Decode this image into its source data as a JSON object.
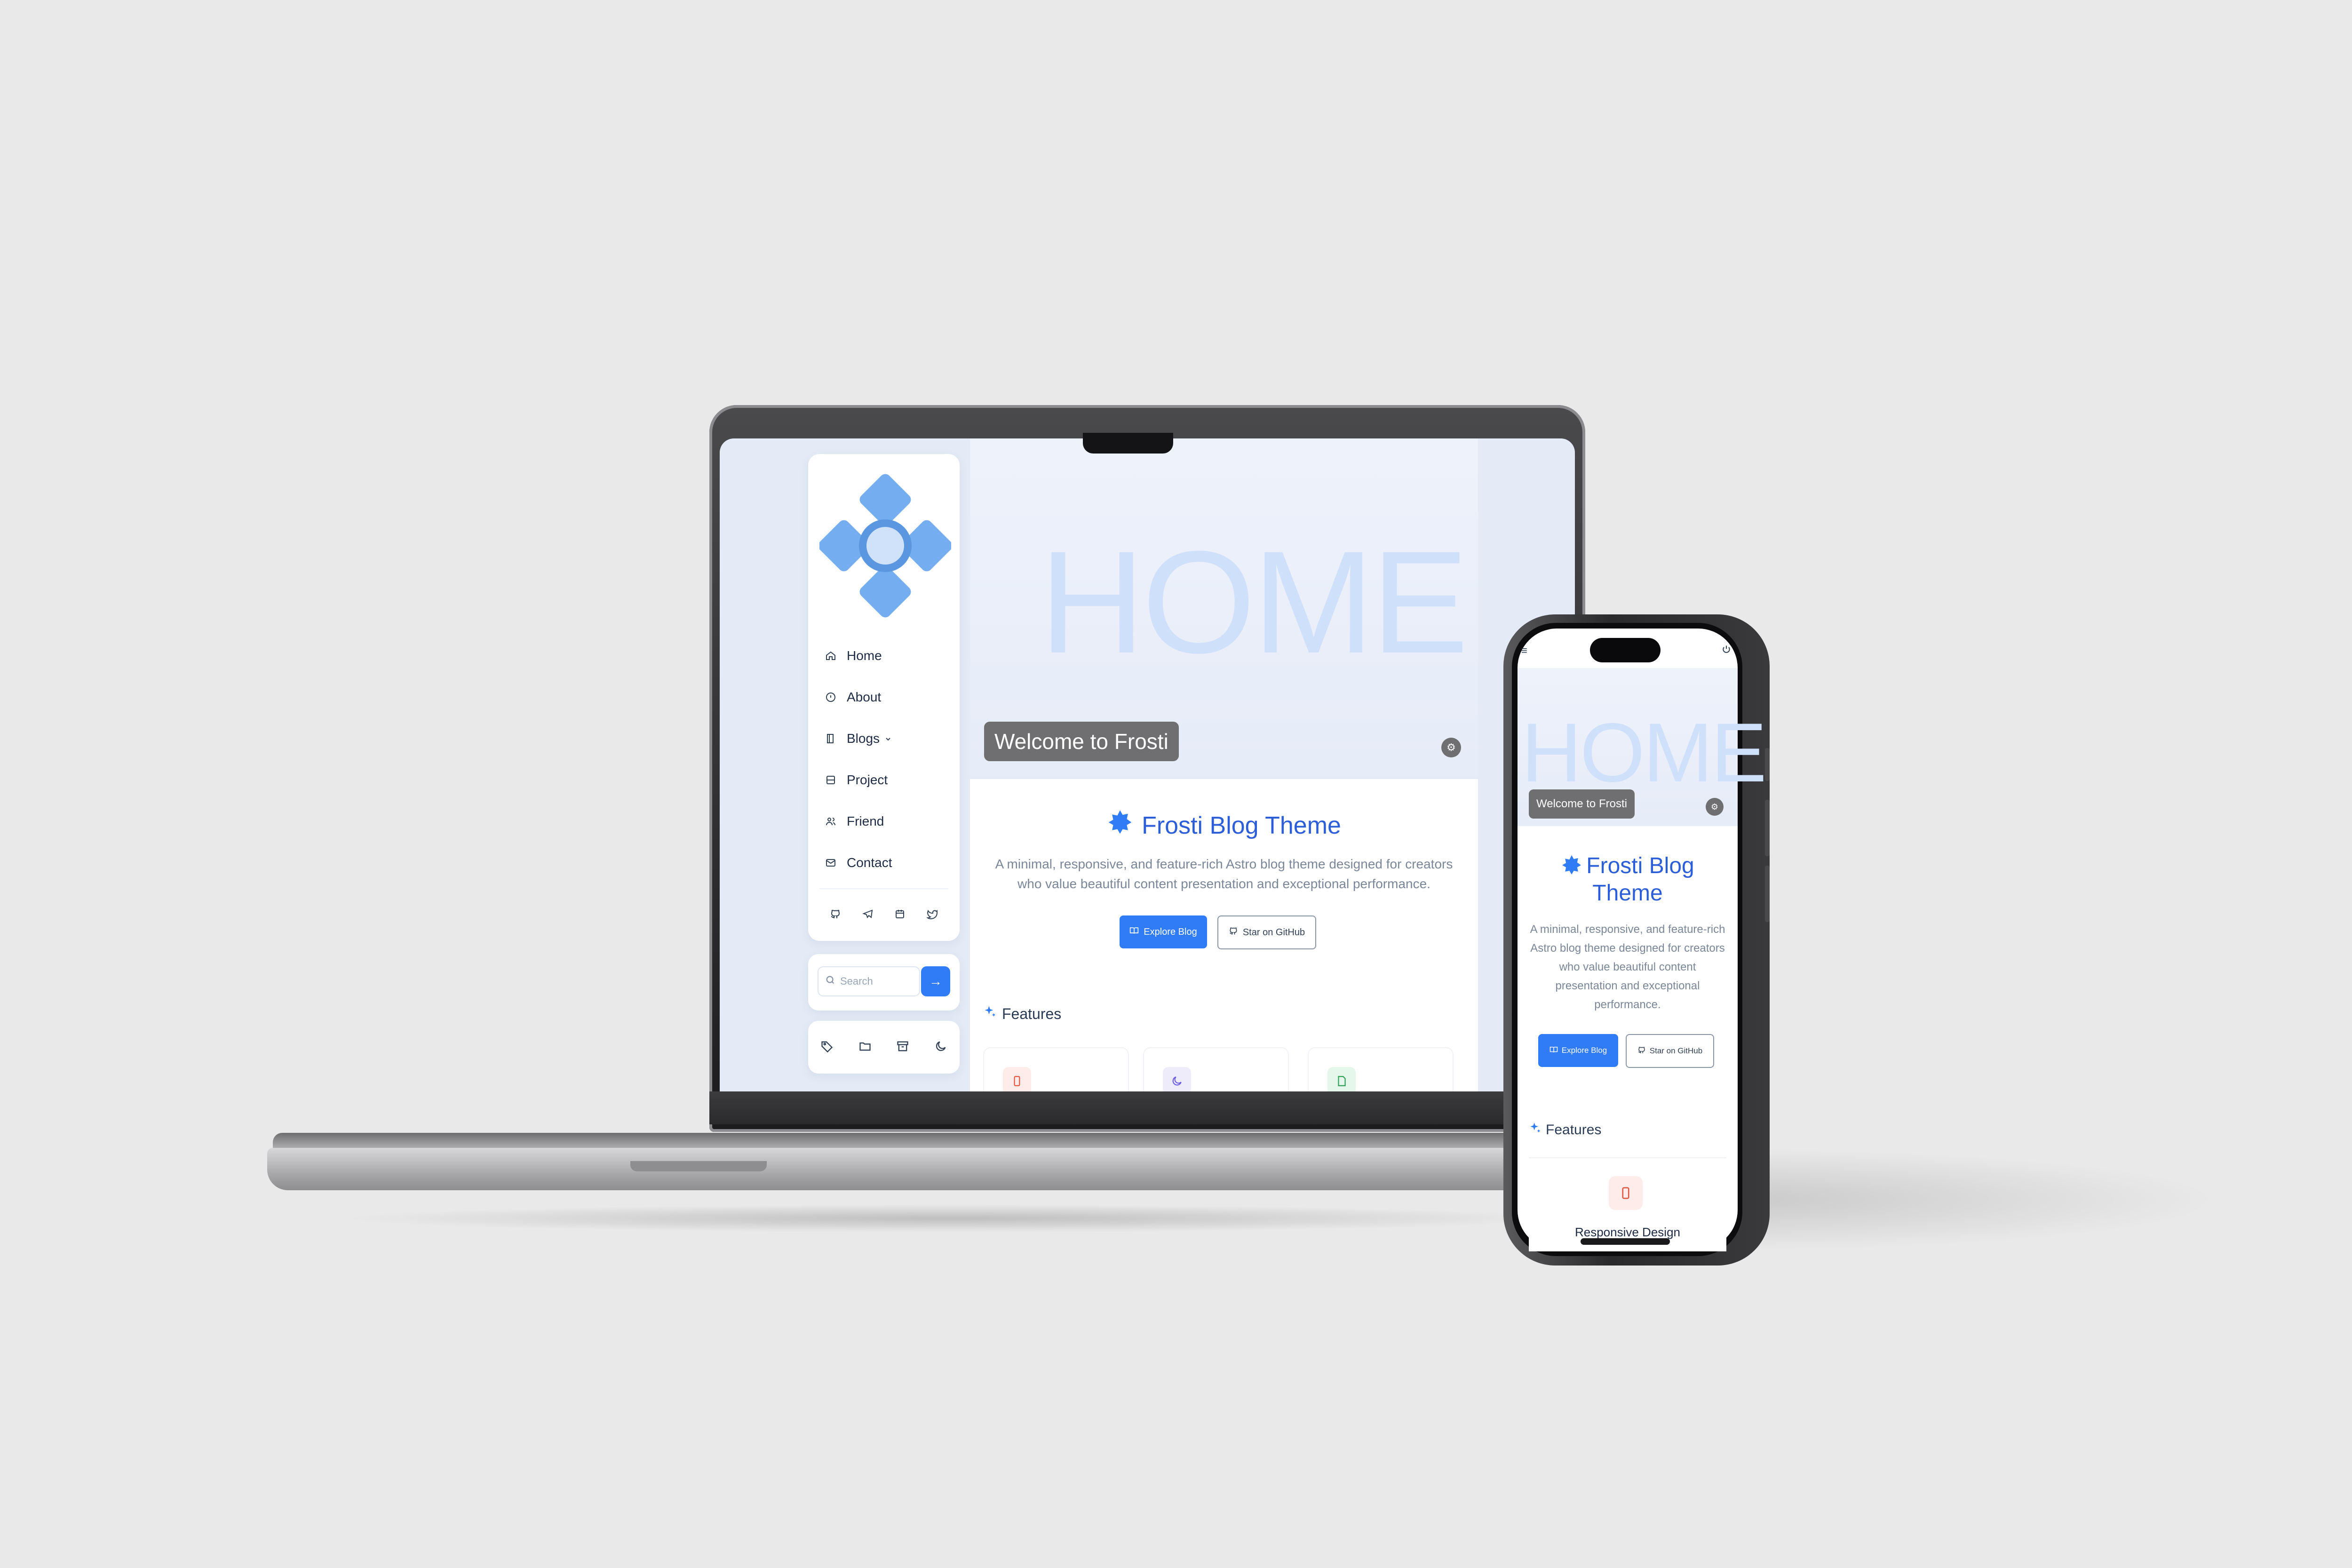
{
  "laptop": {
    "sidebar": {
      "nav_items": [
        {
          "label": "Home",
          "icon": "home-icon"
        },
        {
          "label": "About",
          "icon": "info-icon"
        },
        {
          "label": "Blogs",
          "icon": "book-icon"
        },
        {
          "label": "Project",
          "icon": "project-icon"
        },
        {
          "label": "Friend",
          "icon": "friends-icon"
        },
        {
          "label": "Contact",
          "icon": "contact-icon"
        }
      ],
      "social_icons": [
        "github-icon",
        "telegram-icon",
        "calendar-icon",
        "twitter-icon"
      ],
      "search": {
        "placeholder": "Search",
        "button_symbol": "→"
      },
      "tool_icons": [
        "tag-icon",
        "folder-icon",
        "archive-icon",
        "moon-icon"
      ]
    },
    "hero": {
      "word": "HOME",
      "welcome": "Welcome to Frosti",
      "toggle_symbol": "⚙"
    },
    "main": {
      "title": "Frosti Blog Theme",
      "description": "A minimal, responsive, and feature-rich Astro blog theme designed for creators who value beautiful content presentation and exceptional performance.",
      "explore_button": "Explore Blog",
      "github_button": "Star on GitHub",
      "features_heading": "Features"
    }
  },
  "phone": {
    "menu_symbol": "≡",
    "hero": {
      "word": "HOME",
      "welcome": "Welcome to Frosti",
      "toggle_symbol": "⚙"
    },
    "main": {
      "title": "Frosti Blog Theme",
      "description": "A minimal, responsive, and feature-rich Astro blog theme designed for creators who value beautiful content presentation and exceptional performance.",
      "explore_button": "Explore Blog",
      "github_button": "Star on GitHub",
      "features_heading": "Features",
      "first_feature": "Responsive Design"
    }
  },
  "colors": {
    "accent": "#2f7cf6",
    "title": "#2c5ed8",
    "hero_word": "#cfe0fb",
    "background": "#e9e9e9"
  }
}
